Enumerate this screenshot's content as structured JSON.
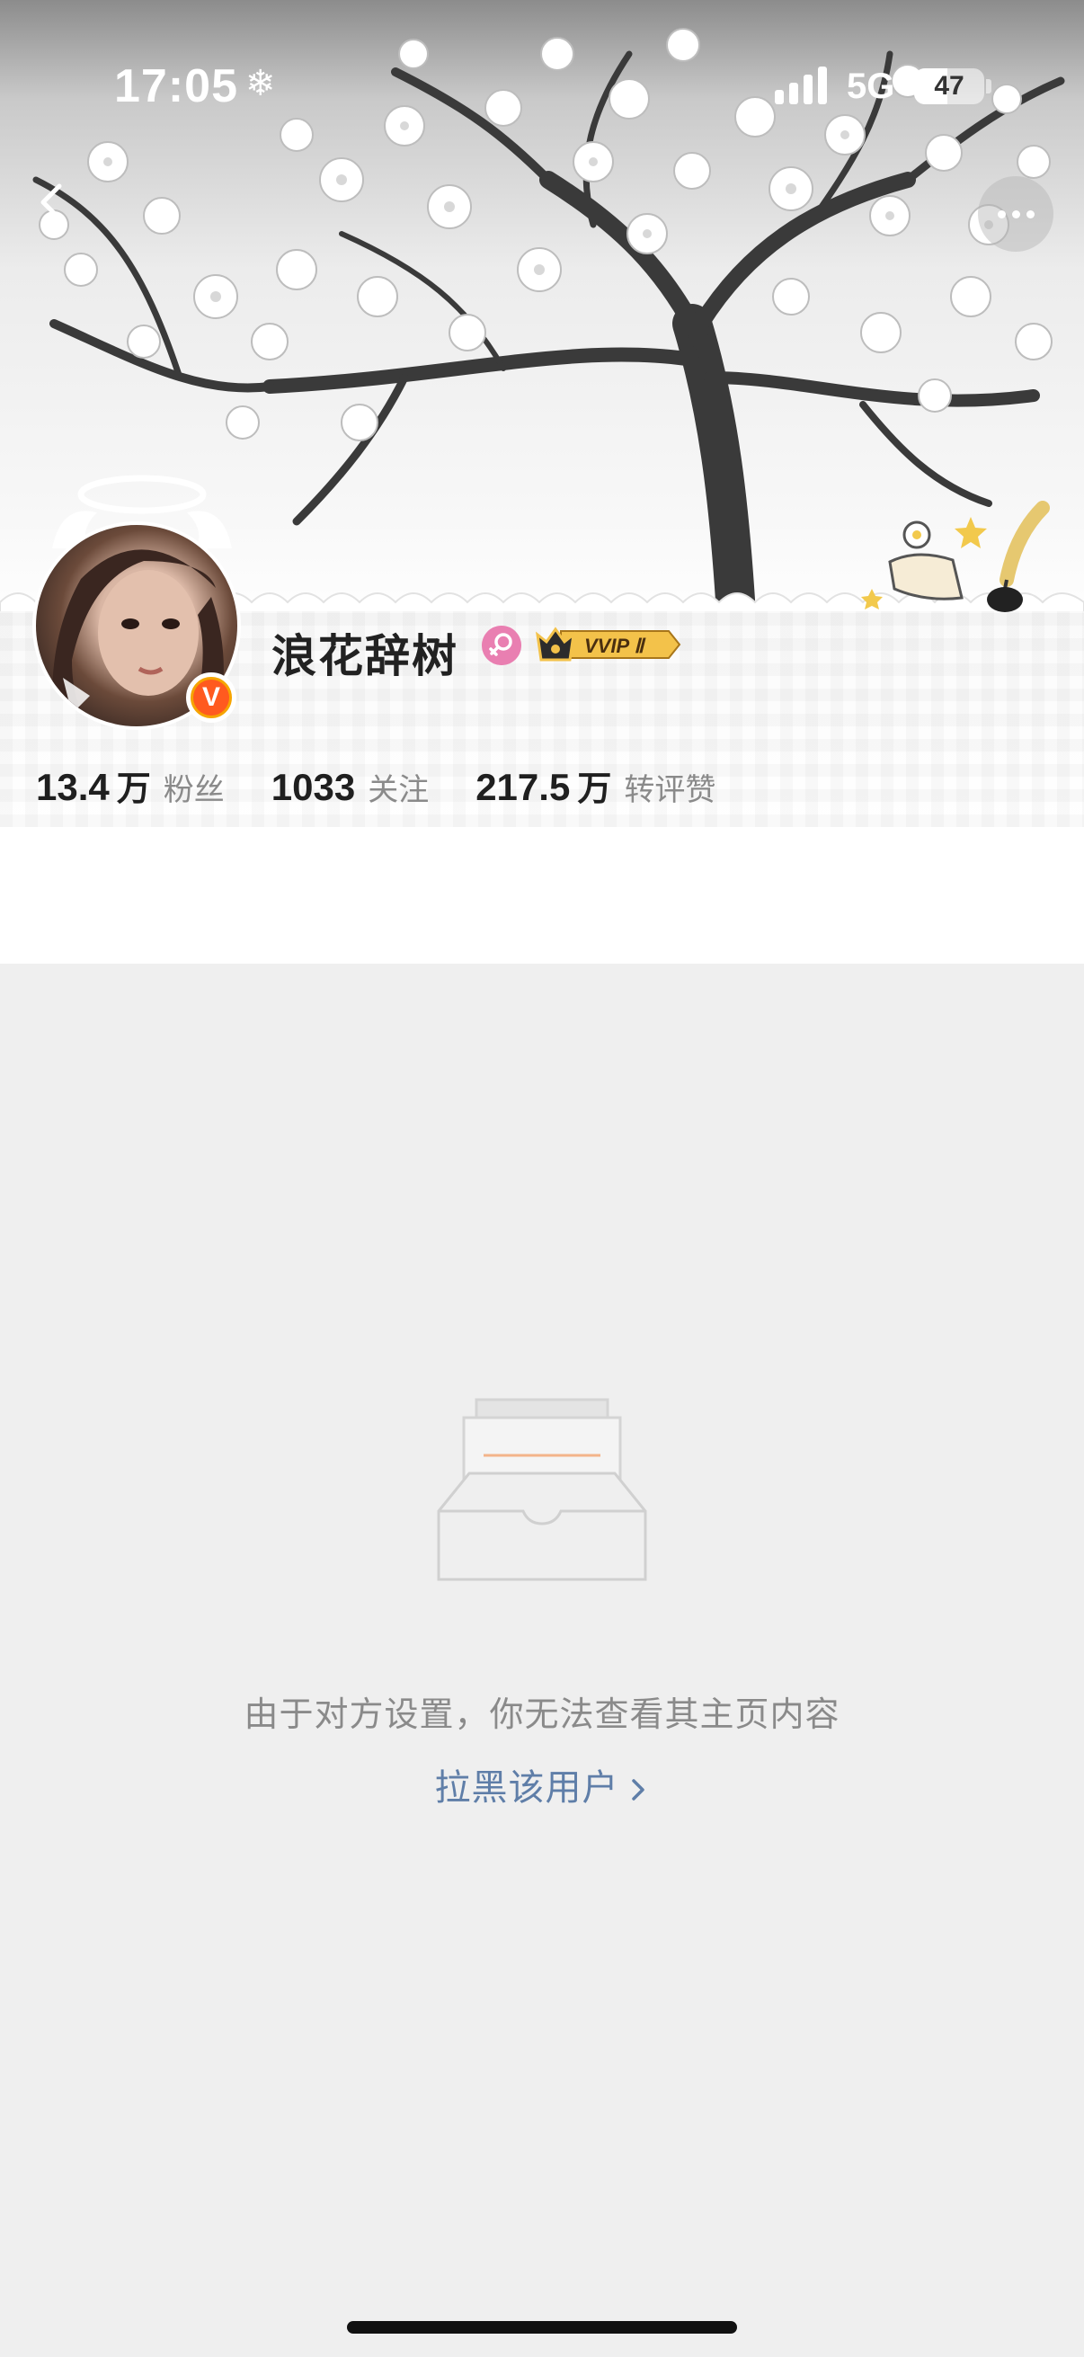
{
  "status_bar": {
    "time": "17:05",
    "weather_icon": "snowflake-icon",
    "network": "5G",
    "battery_level": "47",
    "battery_fraction": 0.47
  },
  "nav": {
    "back_icon": "chevron-left-icon",
    "more_icon": "more-dots-icon"
  },
  "profile": {
    "username": "浪花辞树",
    "verified_label": "V",
    "gender": "female",
    "vip_label": "VVIP Ⅱ",
    "stats": [
      {
        "value": "13.4",
        "unit": "万",
        "label": "粉丝"
      },
      {
        "value": "1033",
        "unit": "",
        "label": "关注"
      },
      {
        "value": "217.5",
        "unit": "万",
        "label": "转评赞"
      }
    ]
  },
  "empty_state": {
    "icon": "empty-inbox-icon",
    "message": "由于对方设置，你无法查看其主页内容",
    "block_link": "拉黑该用户",
    "link_icon": "chevron-right-icon"
  },
  "colors": {
    "link": "#5f7ea8",
    "verified": "#ff5a1f",
    "gender_female": "#e97fb1",
    "page_background": "#efefef"
  }
}
